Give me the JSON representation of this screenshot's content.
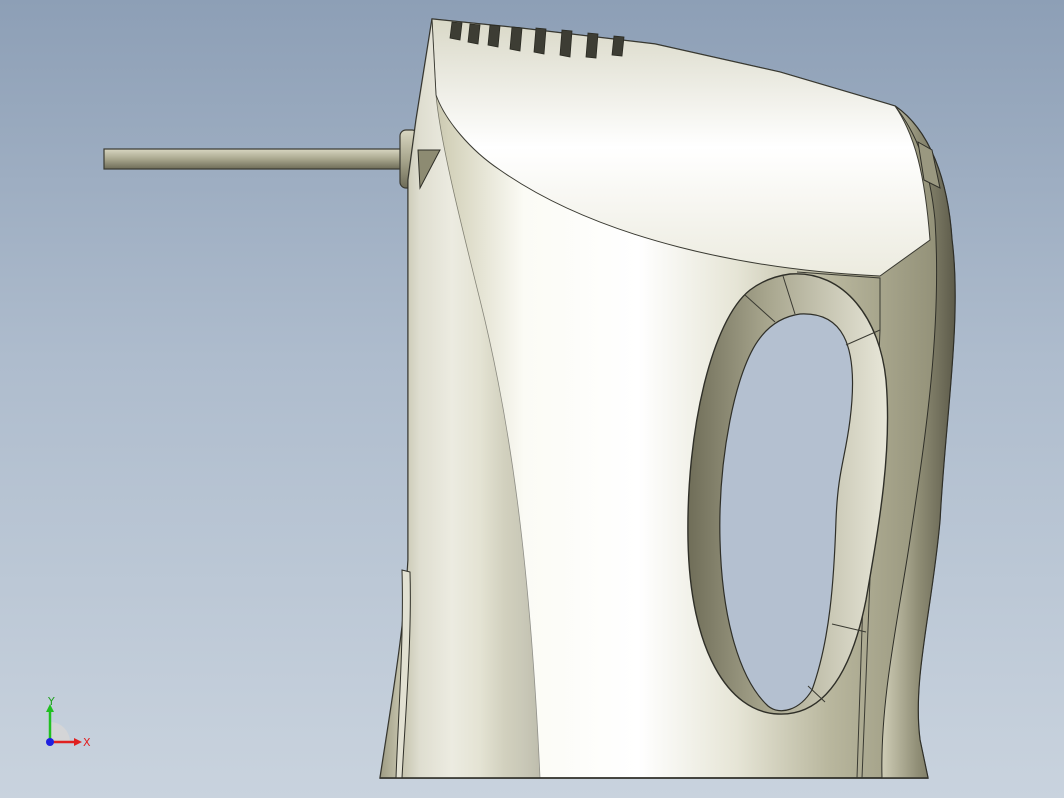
{
  "viewport": {
    "background_top": "#8d9fb6",
    "background_bottom": "#c9d3de"
  },
  "model": {
    "body_color": "#c8c6a8",
    "highlight_color": "#fafaf2",
    "edge_color": "#3a3a32",
    "shadow_color": "#7d7b66"
  },
  "triad": {
    "x_label": "X",
    "y_label": "Y",
    "x_color": "#e02020",
    "y_color": "#20c020",
    "z_color": "#2020e0"
  }
}
